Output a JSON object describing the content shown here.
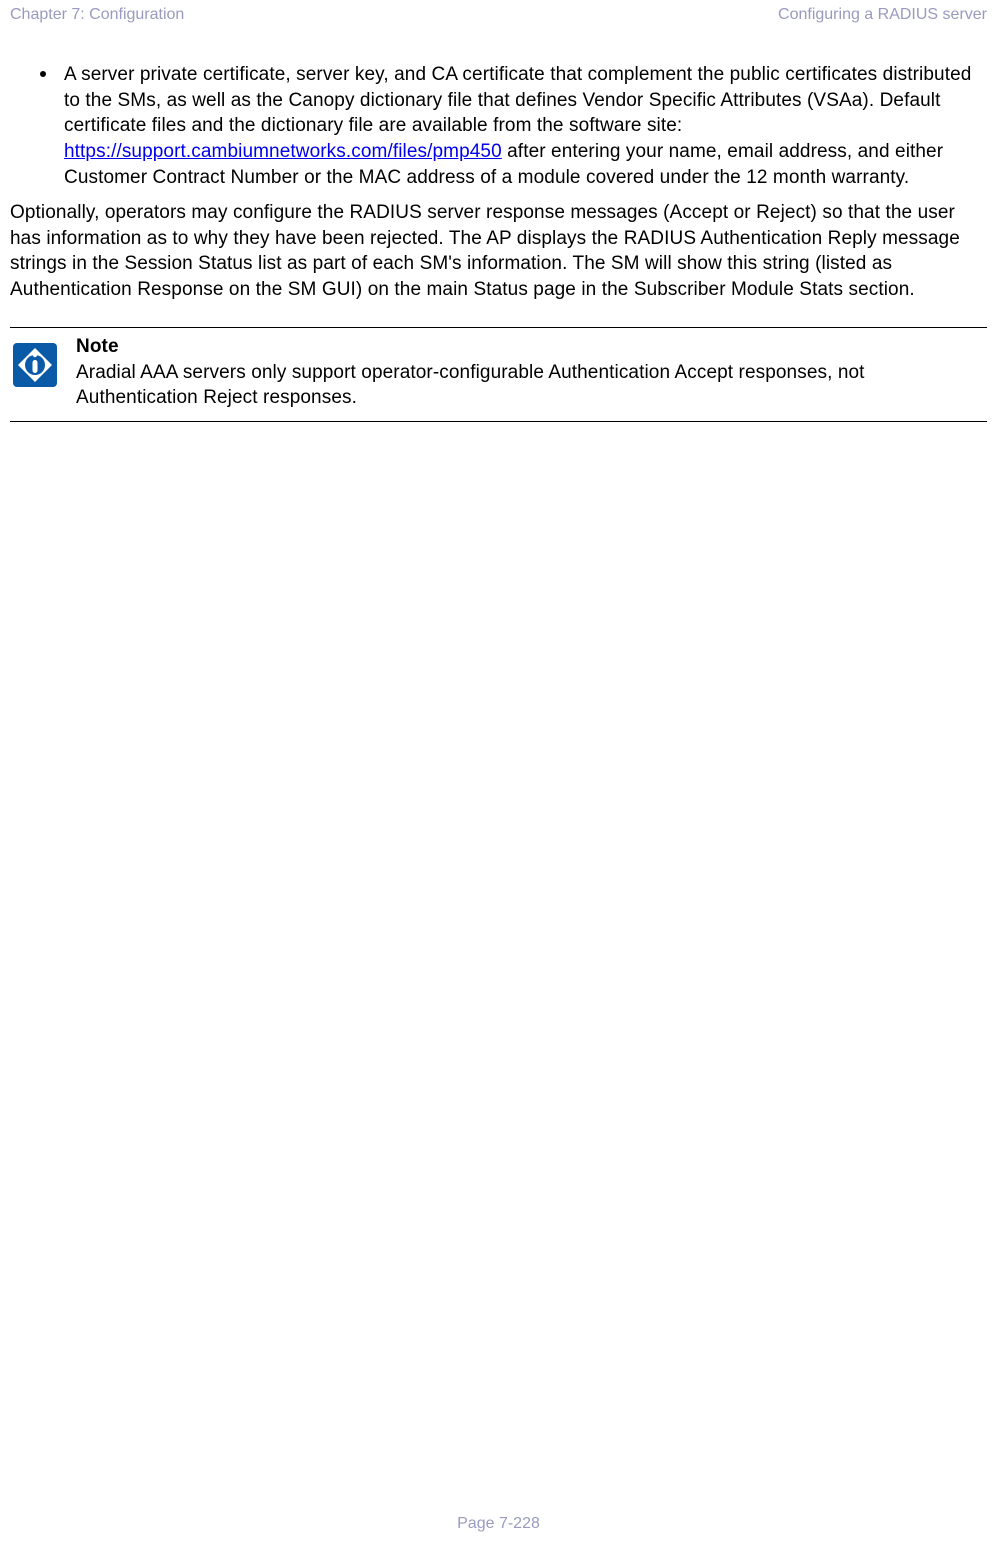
{
  "header": {
    "left": "Chapter 7:  Configuration",
    "right": "Configuring a RADIUS server"
  },
  "bullet": {
    "pre_link": "A server private certificate, server key, and CA certificate that complement the public certificates distributed to the SMs, as well as the Canopy dictionary file that defines Vendor Specific Attributes (VSAa). Default certificate files and the dictionary file are available from the software site: ",
    "link_text": "https://support.cambiumnetworks.com/files/pmp450",
    "post_link": " after entering your name, email address, and either Customer Contract Number or the MAC address of a module covered under the 12 month warranty."
  },
  "paragraph": "Optionally, operators may configure the RADIUS server response messages (Accept or Reject) so that the user has information as to why they have been rejected. The AP displays the RADIUS Authentication Reply message strings in the Session Status list as part of each SM's information. The SM will show this string (listed as Authentication Response on the SM GUI) on the main Status page in the Subscriber Module Stats section.",
  "note": {
    "title": "Note",
    "body": "Aradial AAA servers only support operator-configurable Authentication Accept responses, not Authentication Reject responses."
  },
  "footer": "Page 7-228"
}
